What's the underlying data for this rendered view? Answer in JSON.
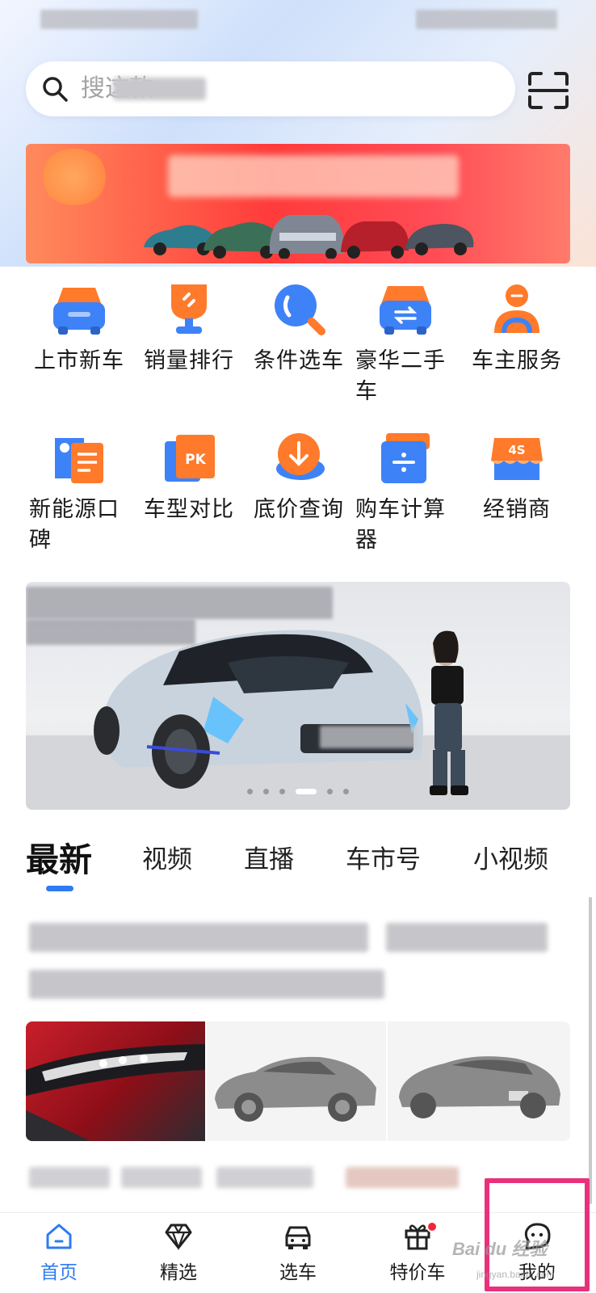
{
  "search": {
    "placeholder": "搜这款"
  },
  "quick_grid": [
    {
      "label": "上市新车",
      "icon": "new-car-icon"
    },
    {
      "label": "销量排行",
      "icon": "trophy-icon"
    },
    {
      "label": "条件选车",
      "icon": "search-filter-icon"
    },
    {
      "label": "豪华二手车",
      "icon": "used-car-icon"
    },
    {
      "label": "车主服务",
      "icon": "owner-service-icon"
    },
    {
      "label": "新能源口碑",
      "icon": "ev-review-icon"
    },
    {
      "label": "车型对比",
      "icon": "pk-compare-icon"
    },
    {
      "label": "底价查询",
      "icon": "price-query-icon"
    },
    {
      "label": "购车计算器",
      "icon": "calculator-icon"
    },
    {
      "label": "经销商",
      "icon": "dealer-4s-icon"
    }
  ],
  "pk_text": "PK",
  "dealer_text": "4S",
  "tabs": [
    {
      "label": "最新",
      "active": true
    },
    {
      "label": "视频"
    },
    {
      "label": "直播"
    },
    {
      "label": "车市号"
    },
    {
      "label": "小视频"
    }
  ],
  "bottom_nav": [
    {
      "label": "首页",
      "icon": "home-icon",
      "active": true
    },
    {
      "label": "精选",
      "icon": "diamond-icon"
    },
    {
      "label": "选车",
      "icon": "car-icon"
    },
    {
      "label": "特价车",
      "icon": "gift-icon",
      "badge": true
    },
    {
      "label": "我的",
      "icon": "profile-chat-icon",
      "highlighted": true
    }
  ],
  "watermark": {
    "text": "Bai du 经验",
    "sub": "jingyan.baidu.com"
  },
  "colors": {
    "accent": "#2f7bf1",
    "icon_orange": "#ff7a2a",
    "icon_blue": "#3e82f7",
    "badge_red": "#f3263b",
    "highlight_pink": "#e8317a"
  }
}
